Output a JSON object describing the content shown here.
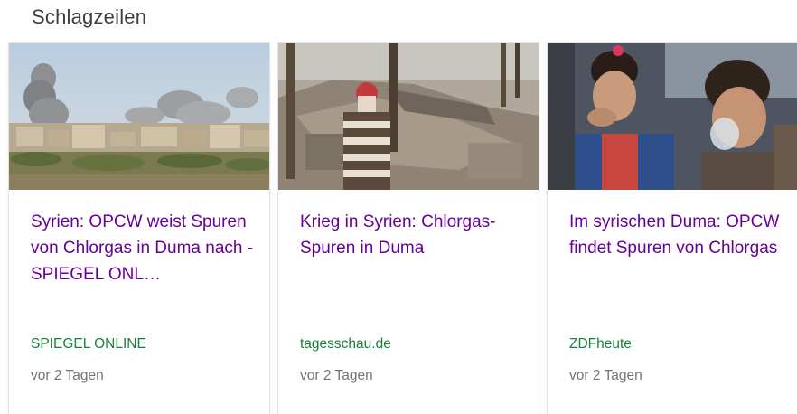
{
  "section": {
    "title": "Schlagzeilen"
  },
  "cards": [
    {
      "title": "Syrien: OPCW weist Spuren von Chlorgas in Duma nach - SPIEGEL ONL…",
      "source": "SPIEGEL ONLINE",
      "age": "vor 2 Tagen",
      "image": "bombed-city-smoke-photo"
    },
    {
      "title": "Krieg in Syrien: Chlorgas-Spuren in Duma",
      "source": "tagesschau.de",
      "age": "vor 2 Tagen",
      "image": "man-in-ruins-photo"
    },
    {
      "title": "Im syrischen Duma: OPCW findet Spuren von Chlorgas",
      "source": "ZDFheute",
      "age": "vor 2 Tagen",
      "image": "children-oxygen-mask-photo"
    }
  ],
  "colors": {
    "title_link": "#660099",
    "source": "#188038",
    "age": "#70757a",
    "heading": "#3c4043"
  }
}
